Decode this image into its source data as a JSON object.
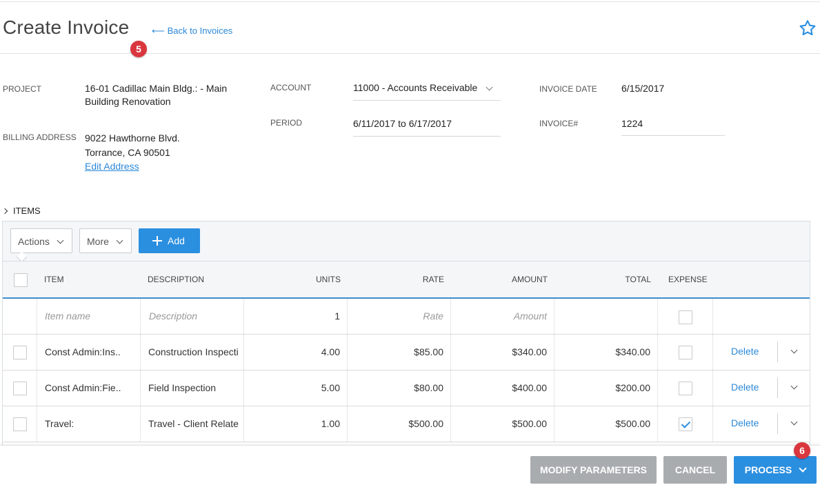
{
  "header": {
    "title": "Create Invoice",
    "back_link": "Back to Invoices",
    "back_arrow": "⟵",
    "step_badge": "5",
    "favorite_icon": "star-outline-icon"
  },
  "form": {
    "project_label": "PROJECT",
    "project_value_line1": "16-01 Cadillac Main Bldg.: - Main",
    "project_value_line2": "Building Renovation",
    "billing_label": "BILLING ADDRESS",
    "billing_line1": "9022 Hawthorne Blvd.",
    "billing_line2": "Torrance, CA 90501",
    "edit_address": "Edit Address",
    "account_label": "ACCOUNT",
    "account_value": "11000 - Accounts Receivable",
    "period_label": "PERIOD",
    "period_value": "6/11/2017 to 6/17/2017",
    "invoice_date_label": "INVOICE DATE",
    "invoice_date_value": "6/15/2017",
    "invoice_no_label": "INVOICE#",
    "invoice_no_value": "1224"
  },
  "items": {
    "section_label": "ITEMS",
    "toolbar": {
      "actions": "Actions",
      "more": "More",
      "add": "Add"
    },
    "columns": [
      "ITEM",
      "DESCRIPTION",
      "UNITS",
      "RATE",
      "AMOUNT",
      "TOTAL",
      "EXPENSE"
    ],
    "new_row": {
      "item_placeholder": "Item name",
      "description_placeholder": "Description",
      "units": "1",
      "rate_placeholder": "Rate",
      "amount_placeholder": "Amount"
    },
    "rows": [
      {
        "item": "Const Admin:Ins..",
        "description": "Construction Inspection",
        "units": "4.00",
        "rate": "$85.00",
        "amount": "$340.00",
        "total": "$340.00",
        "expense": false,
        "delete": "Delete"
      },
      {
        "item": "Const Admin:Fie..",
        "description": "Field Inspection",
        "units": "5.00",
        "rate": "$80.00",
        "amount": "$400.00",
        "total": "$200.00",
        "expense": false,
        "delete": "Delete"
      },
      {
        "item": "Travel:",
        "description": "Travel - Client Related",
        "units": "1.00",
        "rate": "$500.00",
        "amount": "$500.00",
        "total": "$500.00",
        "expense": true,
        "delete": "Delete"
      }
    ]
  },
  "footer": {
    "modify": "MODIFY PARAMETERS",
    "cancel": "CANCEL",
    "process": "PROCESS",
    "step_badge": "6"
  },
  "colors": {
    "accent": "#2b8fe0",
    "badge": "#d9363e",
    "grey_button": "#a9acaf"
  }
}
